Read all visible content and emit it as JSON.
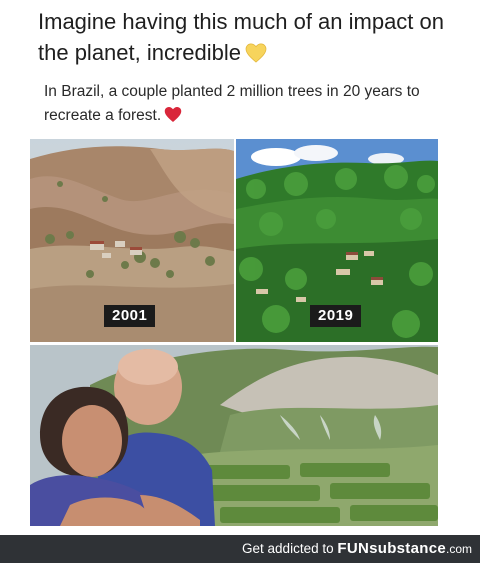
{
  "post": {
    "headline": "Imagine having this much of an impact on the planet, incredible",
    "headline_emoji": "yellow-heart-icon",
    "subtext": "In Brazil, a couple planted 2 million trees in 20 years to recreate a forest.",
    "subtext_emoji": "red-heart-icon"
  },
  "photos": {
    "before_year": "2001",
    "after_year": "2019"
  },
  "footer": {
    "prefix": "Get addicted to",
    "brand": "FUNsubstance",
    "domain": ".com"
  },
  "colors": {
    "footer_bg": "#2f3236",
    "label_bg": "#1b1b1b"
  }
}
